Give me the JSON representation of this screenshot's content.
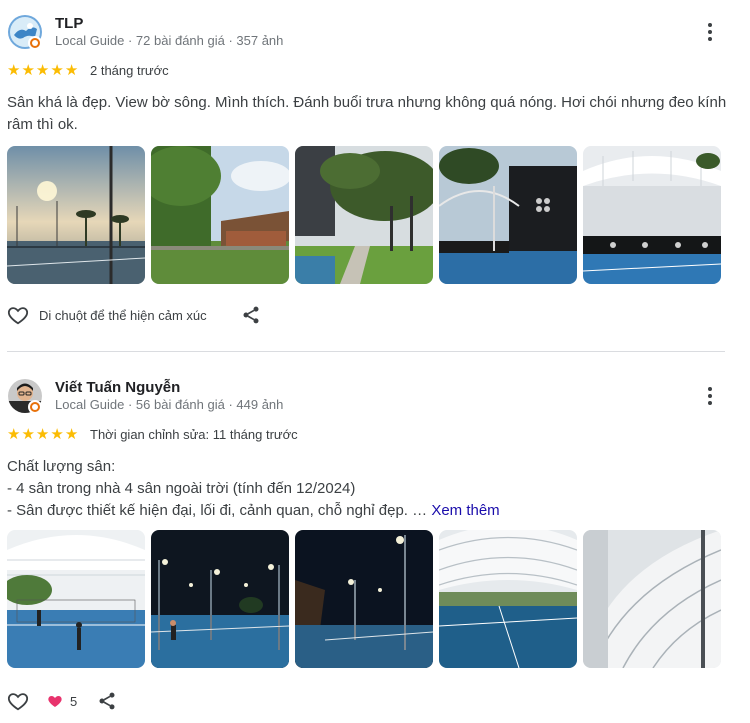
{
  "reviews": [
    {
      "author": "TLP",
      "meta": "Local Guide · 72 bài đánh giá · 357 ảnh",
      "rating": 5,
      "when": "2 tháng trước",
      "text": "Sân khá là đẹp. View bờ sông. Mình thích. Đánh buổi trưa nhưng không quá nóng. Hơi chói nhưng đeo kính râm thì ok.",
      "react_label": "Di chuột để thể hiện cảm xúc"
    },
    {
      "author": "Viết Tuấn Nguyễn",
      "meta": "Local Guide · 56 bài đánh giá · 449 ảnh",
      "rating": 5,
      "when": "Thời gian chỉnh sửa: 11 tháng trước",
      "text_lines": [
        "Chất lượng sân:",
        "- 4 sân trong nhà 4 sân ngoài trời (tính đến 12/2024)",
        "- Sân được thiết kế hiện đại, lối đi, cảnh quan, chỗ nghỉ đẹp. …"
      ],
      "see_more": "Xem thêm",
      "reaction_count": "5"
    }
  ],
  "colors": {
    "star": "#fbbc04",
    "link": "#1a0dab",
    "guide_badge": "#e8710a",
    "reaction_heart": "#e8336d"
  },
  "icons": {
    "more": "more-vert-icon",
    "heart": "heart-outline-icon",
    "share": "share-icon",
    "star": "star-icon"
  }
}
